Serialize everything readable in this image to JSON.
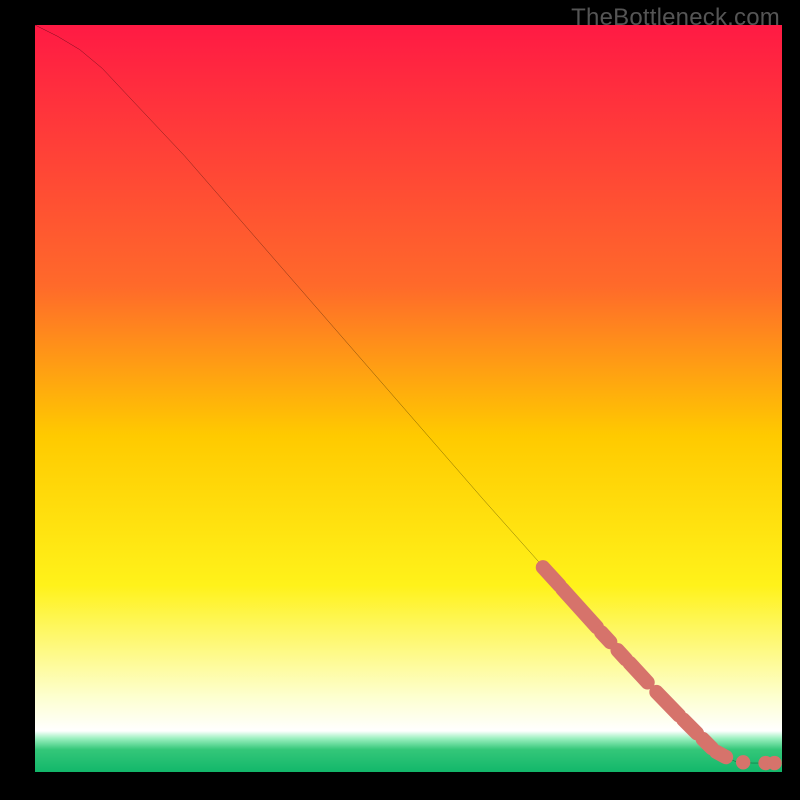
{
  "watermark": "TheBottleneck.com",
  "chart_data": {
    "type": "line",
    "title": "",
    "xlabel": "",
    "ylabel": "",
    "xlim": [
      0,
      100
    ],
    "ylim": [
      0,
      100
    ],
    "background_gradient_stops": [
      {
        "offset": 0,
        "color": "#ff1a44"
      },
      {
        "offset": 0.35,
        "color": "#ff6a2a"
      },
      {
        "offset": 0.55,
        "color": "#ffca00"
      },
      {
        "offset": 0.75,
        "color": "#fff21a"
      },
      {
        "offset": 0.9,
        "color": "#fdffd0"
      },
      {
        "offset": 0.945,
        "color": "#ffffff"
      },
      {
        "offset": 0.955,
        "color": "#9cf0c0"
      },
      {
        "offset": 0.97,
        "color": "#34c779"
      },
      {
        "offset": 1.0,
        "color": "#12b76a"
      }
    ],
    "series": [
      {
        "name": "curve",
        "x": [
          0,
          3,
          6,
          9,
          12,
          20,
          30,
          40,
          50,
          60,
          68,
          75,
          82,
          88,
          92.5,
          94,
          96,
          98,
          100
        ],
        "y": [
          100,
          98.5,
          96.7,
          94.2,
          91,
          82.5,
          71,
          59.5,
          48,
          36.5,
          27.5,
          19.6,
          12,
          5.8,
          2.0,
          1.3,
          1.2,
          1.2,
          1.2
        ],
        "stroke": "#000000",
        "stroke_width": 2
      }
    ],
    "overlay_segments": [
      {
        "x1": 68.0,
        "y1": 27.4,
        "x2": 70.2,
        "y2": 25.0
      },
      {
        "x1": 70.6,
        "y1": 24.5,
        "x2": 75.2,
        "y2": 19.4
      },
      {
        "x1": 75.8,
        "y1": 18.7,
        "x2": 77.0,
        "y2": 17.4
      },
      {
        "x1": 78.0,
        "y1": 16.3,
        "x2": 79.1,
        "y2": 15.1
      },
      {
        "x1": 79.6,
        "y1": 14.6,
        "x2": 82.0,
        "y2": 12.0
      },
      {
        "x1": 83.2,
        "y1": 10.7,
        "x2": 86.2,
        "y2": 7.6
      },
      {
        "x1": 86.8,
        "y1": 7.0,
        "x2": 88.6,
        "y2": 5.2
      },
      {
        "x1": 89.4,
        "y1": 4.4,
        "x2": 90.6,
        "y2": 3.2
      },
      {
        "x1": 91.2,
        "y1": 2.7,
        "x2": 92.5,
        "y2": 2.0
      }
    ],
    "overlay_dots": [
      {
        "x": 94.8,
        "y": 1.3
      },
      {
        "x": 97.8,
        "y": 1.2
      },
      {
        "x": 99.0,
        "y": 1.2
      }
    ],
    "overlay_color": "#d6736b",
    "overlay_radius": 7.2
  }
}
